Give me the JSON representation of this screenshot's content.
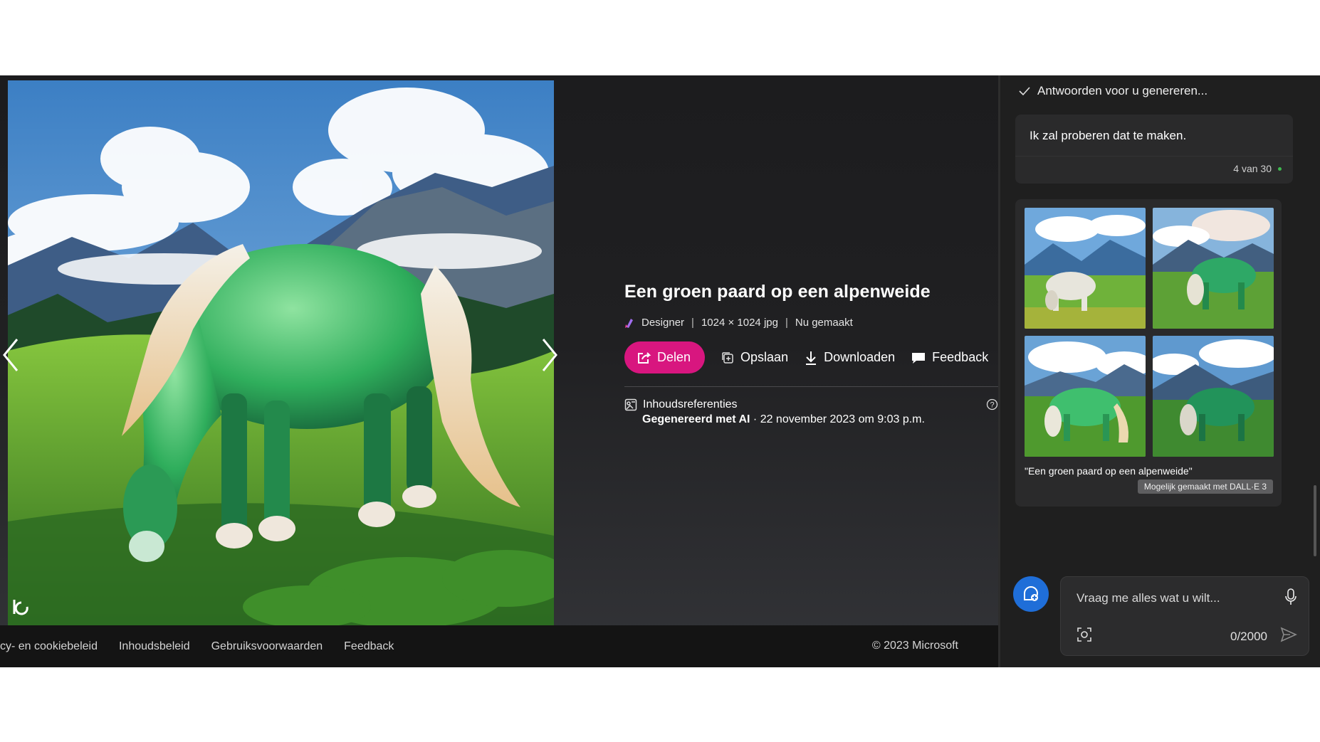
{
  "viewer": {
    "title": "Een groen paard op een alpenweide",
    "meta": {
      "app": "Designer",
      "size": "1024 × 1024 jpg",
      "time": "Nu gemaakt"
    },
    "actions": {
      "share": "Delen",
      "save": "Opslaan",
      "download": "Downloaden",
      "feedback": "Feedback"
    },
    "credentials": {
      "label": "Inhoudsreferenties",
      "generated": "Gegenereerd met AI",
      "date": " · 22 november 2023 om 9:03 p.m."
    }
  },
  "footer": {
    "links": [
      "cy- en cookiebeleid",
      "Inhoudsbeleid",
      "Gebruiksvoorwaarden",
      "Feedback"
    ],
    "copyright": "© 2023 Microsoft"
  },
  "chat": {
    "status": "Antwoorden voor u genereren...",
    "reply": "Ik zal proberen dat te maken.",
    "reply_count": "4 van 30",
    "prompt_caption": "\"Een groen paard op een alpenweide\"",
    "badge": "Mogelijk gemaakt met DALL·E 3",
    "input_placeholder": "Vraag me alles wat u wilt...",
    "char_count": "0/2000"
  },
  "colors": {
    "accent": "#d8167f",
    "chat_button": "#1f6ed8",
    "status_dot": "#3fb950"
  }
}
